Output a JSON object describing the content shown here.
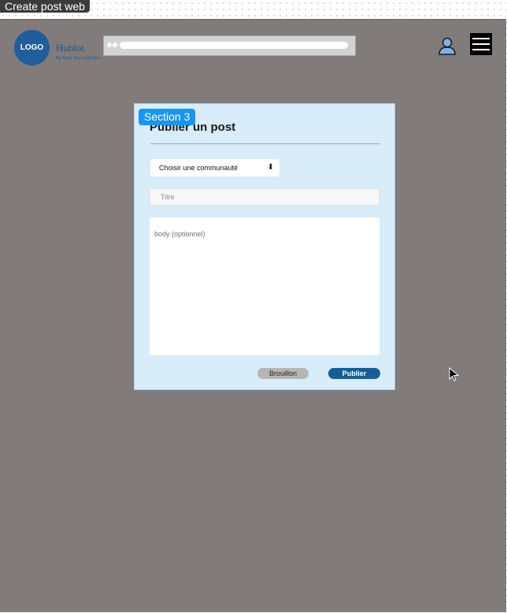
{
  "frame": {
    "label": "Create post web"
  },
  "header": {
    "logo_text": "LOGO",
    "brand_name": "Hublot",
    "brand_tagline": "By Dark Sea Collective",
    "user_icon": "user-icon",
    "menu_icon": "hamburger-menu-icon"
  },
  "section": {
    "badge": "Section 3"
  },
  "form": {
    "title": "Publier un post",
    "community_select": "Choisir une communauté",
    "title_placeholder": "Titre",
    "body_placeholder": "body (optionnel)",
    "draft_label": "Brouillon",
    "publish_label": "Publier"
  },
  "colors": {
    "frame_bg": "#817b7b",
    "card_bg": "#d8ecfa",
    "brand_blue": "#1f5e9a",
    "badge_blue": "#1796f1",
    "publish_button": "#155e95",
    "draft_button": "#b5b5b5"
  }
}
